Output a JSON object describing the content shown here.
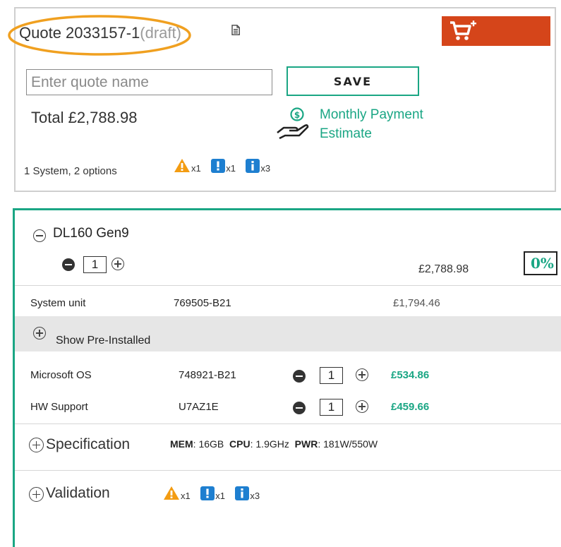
{
  "quote": {
    "title_prefix": "Quote 2033157-1",
    "title_status": "(draft)",
    "name_placeholder": "Enter quote name",
    "save_label": "SAVE",
    "total_text": "Total £2,788.98",
    "payment_line1": "Monthly Payment",
    "payment_line2": "Estimate",
    "summary_text": "1 System, 2 options",
    "counters": {
      "warning": "x1",
      "alert": "x1",
      "info": "x3"
    }
  },
  "system": {
    "name": "DL160 Gen9",
    "quantity": "1",
    "price": "£2,788.98",
    "discount": "0%",
    "unit": {
      "label": "System unit",
      "part": "769505-B21",
      "price": "£1,794.46"
    },
    "preinstalled_label": "Show Pre-Installed",
    "options": [
      {
        "label": "Microsoft OS",
        "part": "748921-B21",
        "qty": "1",
        "price": "£534.86"
      },
      {
        "label": "HW Support",
        "part": "U7AZ1E",
        "qty": "1",
        "price": "£459.66"
      }
    ],
    "specification": {
      "label": "Specification",
      "mem_key": "MEM",
      "mem_val": ": 16GB",
      "cpu_key": "CPU",
      "cpu_val": ": 1.9GHz",
      "pwr_key": "PWR",
      "pwr_val": ": 181W/550W"
    },
    "validation": {
      "label": "Validation",
      "counters": {
        "warning": "x1",
        "alert": "x1",
        "info": "x3"
      }
    }
  },
  "colors": {
    "accent_green": "#1aa684",
    "cart_orange": "#d5451a",
    "warning_orange": "#f39c12",
    "info_blue": "#1e7fd0",
    "highlight_ellipse": "#f0a020"
  },
  "icons": [
    "document-icon",
    "cart-add-icon",
    "payment-hand-icon",
    "warning-icon",
    "alert-icon",
    "info-icon",
    "collapse-icon",
    "expand-icon",
    "minus-icon",
    "plus-icon"
  ]
}
